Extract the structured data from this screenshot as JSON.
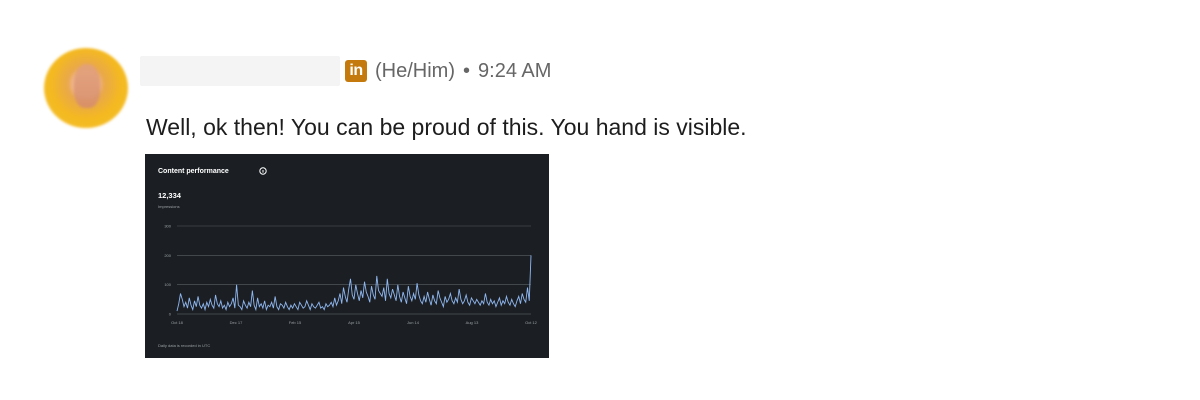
{
  "message": {
    "author_name": "",
    "badge_icon": "linkedin-icon",
    "badge_text": "in",
    "pronouns": "(He/Him)",
    "separator": "•",
    "time": "9:24 AM",
    "text": "Well, ok then! You can be proud of this. You hand is visible."
  },
  "attachment": {
    "type": "image",
    "colors": {
      "background": "#1b1f23",
      "line": "#8fb7f0",
      "text": "#ffffff"
    },
    "chart_data": {
      "type": "line",
      "title": "Content performance",
      "title_icon": "info-icon",
      "summary_value": "12,334",
      "summary_label": "Impressions",
      "y_ticks": [
        "0",
        "100",
        "200",
        "300"
      ],
      "x_ticks": [
        "Oct 18",
        "Dec 17",
        "Feb 15",
        "Apr 15",
        "Jun 14",
        "Aug 13",
        "Oct 12"
      ],
      "ylim": [
        0,
        300
      ],
      "footnote": "Daily data is recorded in UTC",
      "grid": true,
      "series": [
        {
          "values": [
            10,
            35,
            70,
            50,
            25,
            40,
            20,
            55,
            30,
            15,
            45,
            25,
            60,
            30,
            20,
            35,
            15,
            40,
            25,
            50,
            30,
            20,
            65,
            35,
            25,
            45,
            20,
            30,
            15,
            40,
            25,
            35,
            55,
            20,
            100,
            30,
            25,
            15,
            45,
            30,
            20,
            40,
            25,
            80,
            30,
            15,
            55,
            25,
            35,
            20,
            45,
            15,
            30,
            25,
            40,
            20,
            60,
            25,
            15,
            35,
            30,
            20,
            40,
            25,
            15,
            30,
            20,
            35,
            25,
            15,
            40,
            30,
            20,
            25,
            45,
            30,
            15,
            35,
            25,
            20,
            30,
            40,
            20,
            25,
            15,
            35,
            25,
            30,
            40,
            25,
            55,
            30,
            45,
            70,
            35,
            90,
            60,
            40,
            85,
            120,
            65,
            50,
            100,
            70,
            45,
            80,
            55,
            110,
            75,
            60,
            40,
            95,
            65,
            50,
            130,
            80,
            70,
            60,
            90,
            45,
            120,
            70,
            55,
            85,
            65,
            45,
            100,
            60,
            40,
            75,
            55,
            35,
            95,
            60,
            45,
            70,
            50,
            105,
            65,
            45,
            35,
            60,
            40,
            75,
            50,
            30,
            65,
            45,
            35,
            80,
            55,
            40,
            25,
            60,
            40,
            50,
            70,
            45,
            35,
            55,
            40,
            85,
            50,
            35,
            45,
            65,
            40,
            30,
            55,
            45,
            35,
            50,
            40,
            30,
            45,
            35,
            70,
            40,
            30,
            50,
            35,
            45,
            25,
            40,
            55,
            30,
            45,
            35,
            60,
            40,
            30,
            50,
            35,
            25,
            45,
            60,
            35,
            70,
            50,
            40,
            90,
            45,
            200
          ]
        }
      ]
    }
  }
}
